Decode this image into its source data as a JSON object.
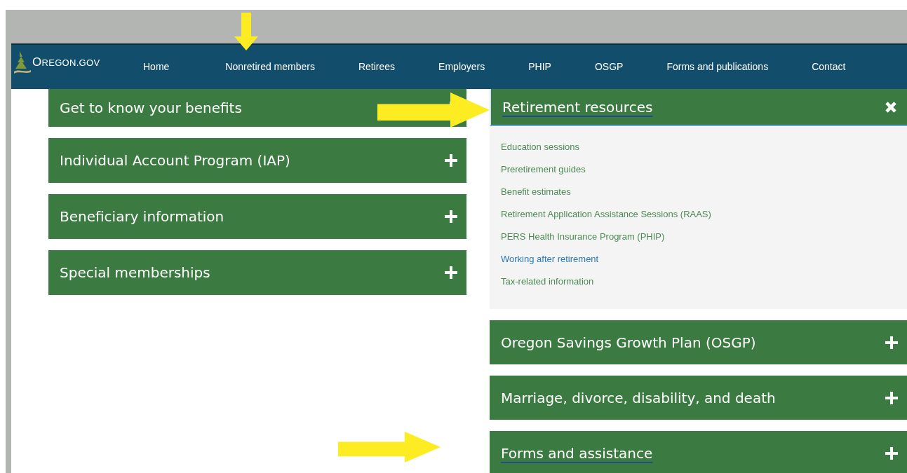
{
  "logo": {
    "text": "OREGON.GOV"
  },
  "nav": [
    {
      "label": "Home",
      "selected": false
    },
    {
      "label": "Nonretired members",
      "selected": false
    },
    {
      "label": "Retirees",
      "selected": false
    },
    {
      "label": "Employers",
      "selected": false
    },
    {
      "label": "PHIP",
      "selected": false
    },
    {
      "label": "OSGP",
      "selected": false
    },
    {
      "label": "Forms and publications",
      "selected": false
    },
    {
      "label": "Contact",
      "selected": false
    }
  ],
  "left_sections": [
    {
      "title": "Get to know your benefits",
      "expanded": false,
      "focused": false
    },
    {
      "title": "Individual Account Program (IAP)",
      "expanded": false,
      "focused": false
    },
    {
      "title": "Beneficiary information",
      "expanded": false,
      "focused": false
    },
    {
      "title": "Special memberships",
      "expanded": false,
      "focused": false
    }
  ],
  "right_sections": [
    {
      "title": "Retirement resources",
      "expanded": true,
      "focused": true,
      "links": [
        {
          "label": "Education sessions",
          "highlighted": false
        },
        {
          "label": "Preretirement guides",
          "highlighted": false
        },
        {
          "label": "Benefit estimates",
          "highlighted": false
        },
        {
          "label": "Retirement Application Assistance Sessions (RAAS)",
          "highlighted": false
        },
        {
          "label": "PERS Health Insurance Program (PHIP)",
          "highlighted": false
        },
        {
          "label": "Working after retirement",
          "highlighted": true
        },
        {
          "label": "Tax-related information",
          "highlighted": false
        }
      ]
    },
    {
      "title": "Oregon Savings Growth Plan (OSGP)",
      "expanded": false,
      "focused": false
    },
    {
      "title": "Marriage, divorce, disability, and death",
      "expanded": false,
      "focused": false
    },
    {
      "title": "Forms and assistance",
      "expanded": false,
      "focused": true
    }
  ],
  "annotations": [
    {
      "kind": "down"
    },
    {
      "kind": "right"
    },
    {
      "kind": "right"
    }
  ]
}
